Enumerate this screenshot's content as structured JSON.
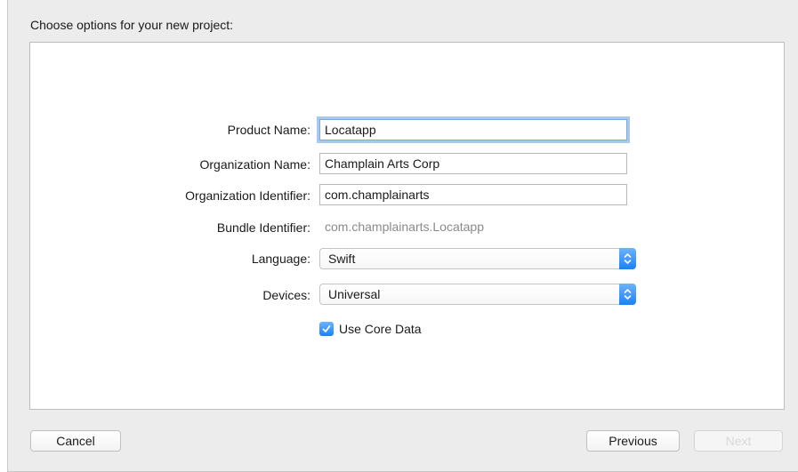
{
  "dialog": {
    "heading": "Choose options for your new project:"
  },
  "form": {
    "product_name_label": "Product Name:",
    "product_name_value": "Locatapp",
    "organization_name_label": "Organization Name:",
    "organization_name_value": "Champlain Arts Corp",
    "organization_identifier_label": "Organization Identifier:",
    "organization_identifier_value": "com.champlainarts",
    "bundle_identifier_label": "Bundle Identifier:",
    "bundle_identifier_value": "com.champlainarts.Locatapp",
    "language_label": "Language:",
    "language_value": "Swift",
    "devices_label": "Devices:",
    "devices_value": "Universal",
    "use_core_data_label": "Use Core Data",
    "use_core_data_checked": true
  },
  "footer": {
    "cancel_label": "Cancel",
    "previous_label": "Previous",
    "next_label": "Next"
  },
  "icons": {
    "stepper": "up-down-chevron-icon",
    "checkmark": "checkmark-icon"
  },
  "colors": {
    "accent": "#1a82fb",
    "focus_ring": "#a8c8ee",
    "sheet_background": "#ececec"
  }
}
